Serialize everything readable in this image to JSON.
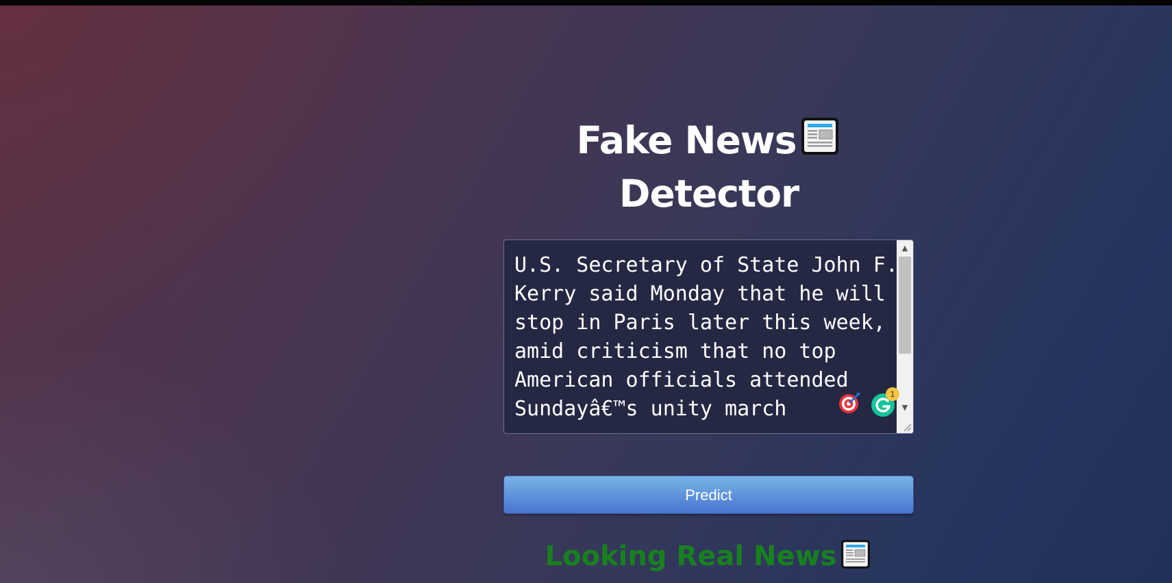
{
  "app": {
    "title_line1": "Fake News",
    "title_line2": "Detector"
  },
  "input": {
    "text": "U.S. Secretary of State John F. Kerry said Monday that he will stop in Paris later this week, amid criticism that no top American officials attended Sundayâ€™s unity march"
  },
  "actions": {
    "predict_label": "Predict"
  },
  "result": {
    "label": "Looking Real News"
  },
  "extensions": {
    "grammarly_count": "1"
  },
  "icons": {
    "title_icon": "newspaper-icon",
    "result_icon": "newspaper-icon"
  },
  "colors": {
    "result_text": "#18801f",
    "button": "#5f95dc"
  }
}
